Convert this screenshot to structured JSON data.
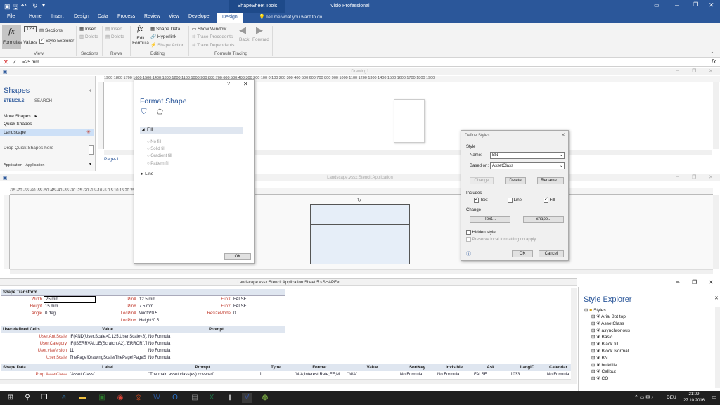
{
  "titlebar": {
    "qat_icons": [
      "save-icon",
      "undo-icon",
      "redo-icon",
      "refresh-icon"
    ],
    "context": "ShapeSheet Tools",
    "title": "Visio Professional"
  },
  "tabs": [
    "File",
    "Home",
    "Insert",
    "Design",
    "Data",
    "Process",
    "Review",
    "View",
    "Developer",
    "Design"
  ],
  "tell_me": "Tell me what you want to do...",
  "ribbon": {
    "formulas": "Formulas",
    "values": "Values",
    "sections": "Sections",
    "style_explorer": "Style Explorer",
    "group_view": "View",
    "insert1": "Insert",
    "delete1": "Delete",
    "group_sections": "Sections",
    "insert2": "Insert",
    "delete2": "Delete",
    "group_rows": "Rows",
    "edit_formula": "Edit Formula",
    "shape_data": "Shape Data",
    "hyperlink": "Hyperlink",
    "shape_action": "Shape Action",
    "group_editing": "Editing",
    "show_window": "Show Window",
    "trace_precedents": "Trace Precedents",
    "trace_dependents": "Trace Dependents",
    "back": "Back",
    "forward": "Forward",
    "group_tracing": "Formula Tracing"
  },
  "formula_bar": {
    "value": "=25 mm"
  },
  "drawing1": {
    "title": "Drawing1"
  },
  "shapes": {
    "title": "Shapes",
    "stencils": "STENCILS",
    "search": "SEARCH",
    "more": "More Shapes",
    "quick": "Quick Shapes",
    "landscape": "Landscape",
    "drop": "Drop Quick Shapes here",
    "item1": "Application",
    "item2": "Application",
    "page_tab": "Page-1"
  },
  "ruler1": "1900 1800 1700 1600 1500 1400 1300 1200 1100 1000 900 800 700 600 500 400 300 200 100 0 100 200 300 400 500 600 700 800 900 1000 1100 1200 1300 1400 1500 1600 1700 1800 1900",
  "stencil_window": {
    "title": "Landscape.vssx:Stencil:Application"
  },
  "ruler2": "-75 -70 -65 -60 -55 -50 -45 -40 -35 -30 -25 -20 -15 -10 -5 0 5 10 15 20 25 30 35 40 45 50 55 60 65 70 75",
  "format_shape": {
    "title": "Format Shape",
    "fill": "Fill",
    "no_fill": "No fill",
    "solid_fill": "Solid fill",
    "gradient_fill": "Gradient fill",
    "pattern_fill": "Pattern fill",
    "line": "Line",
    "ok": "OK"
  },
  "define_styles": {
    "title": "Define Styles",
    "style": "Style",
    "name_label": "Name:",
    "name_value": "BN",
    "based_label": "Based on:",
    "based_value": "AssetClass",
    "change": "Change",
    "delete": "Delete",
    "rename": "Rename...",
    "includes": "Includes",
    "text": "Text",
    "line": "Line",
    "fill": "Fill",
    "change_section": "Change",
    "text_btn": "Text...",
    "shape_btn": "Shape...",
    "hidden": "Hidden style",
    "preserve": "Preserve local formatting on apply",
    "ok": "OK",
    "cancel": "Cancel"
  },
  "shapesheet": {
    "title": "Landscape.vssx:Stencil:Application:Sheet.5 <SHAPE>",
    "transform_title": "Shape Transform",
    "transform": [
      {
        "l1": "Width",
        "v1": "25 mm",
        "l2": "PinX",
        "v2": "12.5 mm",
        "l3": "FlipX",
        "v3": "FALSE"
      },
      {
        "l1": "Height",
        "v1": "15 mm",
        "l2": "PinY",
        "v2": "7.5 mm",
        "l3": "FlipY",
        "v3": "FALSE"
      },
      {
        "l1": "Angle",
        "v1": "0 deg",
        "l2": "LocPinX",
        "v2": "Width*0.5",
        "l3": "ResizeMode",
        "v3": "0"
      },
      {
        "l1": "",
        "v1": "",
        "l2": "LocPinY",
        "v2": "Height*0.5",
        "l3": "",
        "v3": ""
      }
    ],
    "udc_headers": [
      "User-defined Cells",
      "Value",
      "Prompt"
    ],
    "udc": [
      {
        "n": "User.AntiScale",
        "v": "IF(AND(User.Scale>0.125,User.Scale<8),",
        "p": "No Formula"
      },
      {
        "n": "User.Category",
        "v": "IF(ISERRVALUE(Scratch.A2),\"ERROR\",TI",
        "p": "No Formula"
      },
      {
        "n": "User.visVersion",
        "v": "11",
        "p": "No Formula"
      },
      {
        "n": "User.Scale",
        "v": "ThePage!DrawingScale/ThePage!PageS",
        "p": "No Formula"
      }
    ],
    "sd_headers": [
      "Shape Data",
      "Label",
      "Prompt",
      "Type",
      "Format",
      "Value",
      "SortKey",
      "Invisible",
      "Ask",
      "LangID",
      "Calendar"
    ],
    "sd_row": [
      "Prop.AssetClass",
      "\"Asset Class\"",
      "\"The main asset class(es) covered\"",
      "1",
      "\"N/A;Interest Rate;FE;M",
      "\"N/A\"",
      "No Formula",
      "No Formula",
      "FALSE",
      "1033",
      "No Formula"
    ]
  },
  "style_explorer": {
    "title": "Style Explorer",
    "root": "Styles",
    "items": [
      "Arial 8pt top",
      "AssetClass",
      "asynchronous",
      "Basic",
      "Black fill",
      "Block Normal",
      "BN",
      "bulk/file",
      "Callout",
      "CO"
    ]
  },
  "taskbar": {
    "lang": "DEU",
    "time": "21:09",
    "date": "27.10.2016"
  }
}
